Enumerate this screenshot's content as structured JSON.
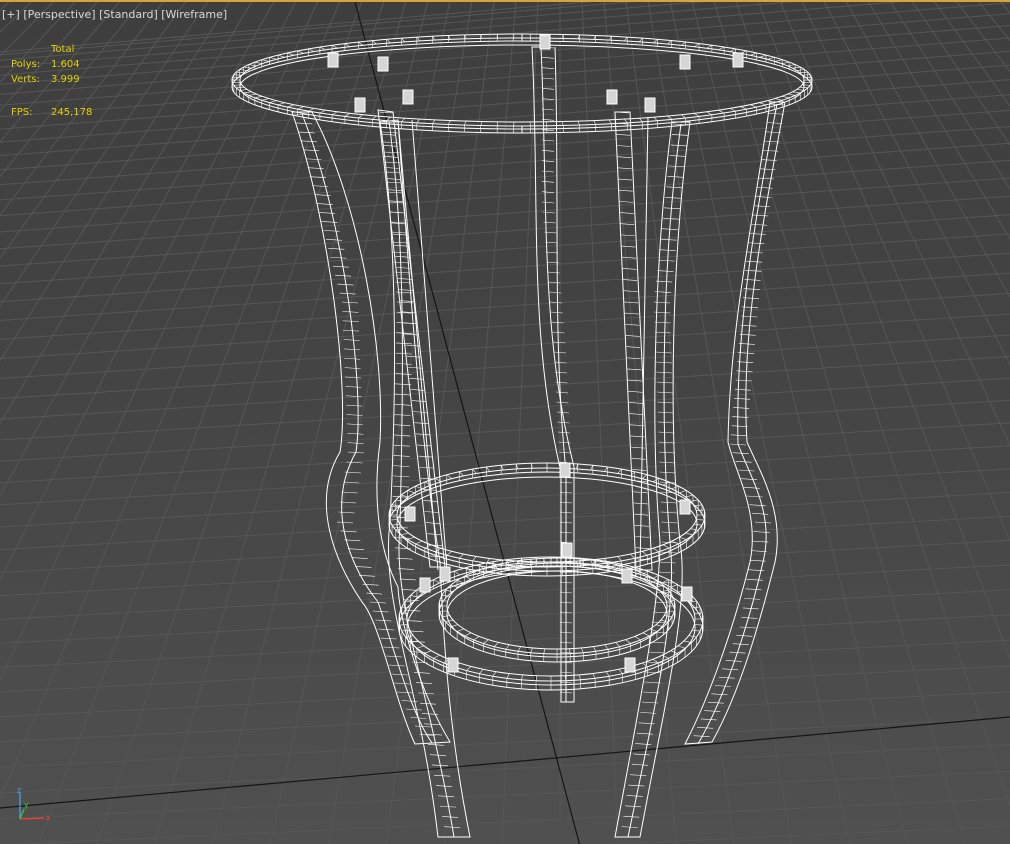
{
  "viewport": {
    "labels": [
      "[+]",
      "[Perspective]",
      "[Standard]",
      "[Wireframe]"
    ],
    "border_color": "#d7a43a",
    "background_top": "#3e3e3e",
    "background_bottom": "#505050",
    "grid_color": "#575757",
    "wire_color": "#ffffff"
  },
  "stats": {
    "header": "Total",
    "polys_label": "Polys:",
    "polys_value": "1.604",
    "verts_label": "Verts:",
    "verts_value": "3.999",
    "fps_label": "FPS:",
    "fps_value": "245,178",
    "text_color": "#e5d000"
  },
  "axis_gizmo": {
    "x": "x",
    "y": "y",
    "z": "z"
  }
}
